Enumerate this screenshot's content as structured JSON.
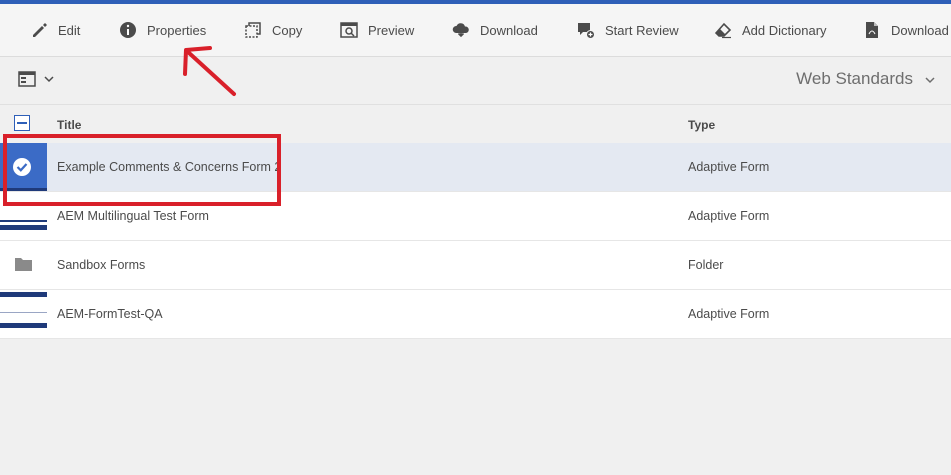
{
  "toolbar": {
    "edit_label": "Edit",
    "properties_label": "Properties",
    "copy_label": "Copy",
    "preview_label": "Preview",
    "download_label": "Download",
    "start_review_label": "Start Review",
    "add_dictionary_label": "Add Dictionary",
    "download_pdf_label": "Download P"
  },
  "subbar": {
    "view_label": "Web Standards"
  },
  "table": {
    "headers": {
      "title": "Title",
      "type": "Type"
    },
    "rows": [
      {
        "title": "Example Comments & Concerns Form 2",
        "type": "Adaptive Form",
        "selected": true
      },
      {
        "title": "AEM Multilingual Test Form",
        "type": "Adaptive Form",
        "selected": false
      },
      {
        "title": "Sandbox Forms",
        "type": "Folder",
        "selected": false
      },
      {
        "title": "AEM-FormTest-QA",
        "type": "Adaptive Form",
        "selected": false
      }
    ]
  },
  "colors": {
    "accent": "#2e5fb8",
    "selected_row": "#e4e9f2",
    "annotation": "#d9202a"
  }
}
